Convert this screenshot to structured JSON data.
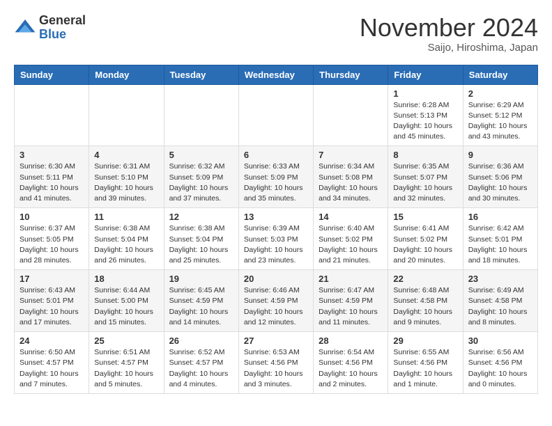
{
  "logo": {
    "general": "General",
    "blue": "Blue"
  },
  "title": "November 2024",
  "subtitle": "Saijo, Hiroshima, Japan",
  "days_header": [
    "Sunday",
    "Monday",
    "Tuesday",
    "Wednesday",
    "Thursday",
    "Friday",
    "Saturday"
  ],
  "weeks": [
    [
      {
        "day": "",
        "info": ""
      },
      {
        "day": "",
        "info": ""
      },
      {
        "day": "",
        "info": ""
      },
      {
        "day": "",
        "info": ""
      },
      {
        "day": "",
        "info": ""
      },
      {
        "day": "1",
        "info": "Sunrise: 6:28 AM\nSunset: 5:13 PM\nDaylight: 10 hours and 45 minutes."
      },
      {
        "day": "2",
        "info": "Sunrise: 6:29 AM\nSunset: 5:12 PM\nDaylight: 10 hours and 43 minutes."
      }
    ],
    [
      {
        "day": "3",
        "info": "Sunrise: 6:30 AM\nSunset: 5:11 PM\nDaylight: 10 hours and 41 minutes."
      },
      {
        "day": "4",
        "info": "Sunrise: 6:31 AM\nSunset: 5:10 PM\nDaylight: 10 hours and 39 minutes."
      },
      {
        "day": "5",
        "info": "Sunrise: 6:32 AM\nSunset: 5:09 PM\nDaylight: 10 hours and 37 minutes."
      },
      {
        "day": "6",
        "info": "Sunrise: 6:33 AM\nSunset: 5:09 PM\nDaylight: 10 hours and 35 minutes."
      },
      {
        "day": "7",
        "info": "Sunrise: 6:34 AM\nSunset: 5:08 PM\nDaylight: 10 hours and 34 minutes."
      },
      {
        "day": "8",
        "info": "Sunrise: 6:35 AM\nSunset: 5:07 PM\nDaylight: 10 hours and 32 minutes."
      },
      {
        "day": "9",
        "info": "Sunrise: 6:36 AM\nSunset: 5:06 PM\nDaylight: 10 hours and 30 minutes."
      }
    ],
    [
      {
        "day": "10",
        "info": "Sunrise: 6:37 AM\nSunset: 5:05 PM\nDaylight: 10 hours and 28 minutes."
      },
      {
        "day": "11",
        "info": "Sunrise: 6:38 AM\nSunset: 5:04 PM\nDaylight: 10 hours and 26 minutes."
      },
      {
        "day": "12",
        "info": "Sunrise: 6:38 AM\nSunset: 5:04 PM\nDaylight: 10 hours and 25 minutes."
      },
      {
        "day": "13",
        "info": "Sunrise: 6:39 AM\nSunset: 5:03 PM\nDaylight: 10 hours and 23 minutes."
      },
      {
        "day": "14",
        "info": "Sunrise: 6:40 AM\nSunset: 5:02 PM\nDaylight: 10 hours and 21 minutes."
      },
      {
        "day": "15",
        "info": "Sunrise: 6:41 AM\nSunset: 5:02 PM\nDaylight: 10 hours and 20 minutes."
      },
      {
        "day": "16",
        "info": "Sunrise: 6:42 AM\nSunset: 5:01 PM\nDaylight: 10 hours and 18 minutes."
      }
    ],
    [
      {
        "day": "17",
        "info": "Sunrise: 6:43 AM\nSunset: 5:01 PM\nDaylight: 10 hours and 17 minutes."
      },
      {
        "day": "18",
        "info": "Sunrise: 6:44 AM\nSunset: 5:00 PM\nDaylight: 10 hours and 15 minutes."
      },
      {
        "day": "19",
        "info": "Sunrise: 6:45 AM\nSunset: 4:59 PM\nDaylight: 10 hours and 14 minutes."
      },
      {
        "day": "20",
        "info": "Sunrise: 6:46 AM\nSunset: 4:59 PM\nDaylight: 10 hours and 12 minutes."
      },
      {
        "day": "21",
        "info": "Sunrise: 6:47 AM\nSunset: 4:59 PM\nDaylight: 10 hours and 11 minutes."
      },
      {
        "day": "22",
        "info": "Sunrise: 6:48 AM\nSunset: 4:58 PM\nDaylight: 10 hours and 9 minutes."
      },
      {
        "day": "23",
        "info": "Sunrise: 6:49 AM\nSunset: 4:58 PM\nDaylight: 10 hours and 8 minutes."
      }
    ],
    [
      {
        "day": "24",
        "info": "Sunrise: 6:50 AM\nSunset: 4:57 PM\nDaylight: 10 hours and 7 minutes."
      },
      {
        "day": "25",
        "info": "Sunrise: 6:51 AM\nSunset: 4:57 PM\nDaylight: 10 hours and 5 minutes."
      },
      {
        "day": "26",
        "info": "Sunrise: 6:52 AM\nSunset: 4:57 PM\nDaylight: 10 hours and 4 minutes."
      },
      {
        "day": "27",
        "info": "Sunrise: 6:53 AM\nSunset: 4:56 PM\nDaylight: 10 hours and 3 minutes."
      },
      {
        "day": "28",
        "info": "Sunrise: 6:54 AM\nSunset: 4:56 PM\nDaylight: 10 hours and 2 minutes."
      },
      {
        "day": "29",
        "info": "Sunrise: 6:55 AM\nSunset: 4:56 PM\nDaylight: 10 hours and 1 minute."
      },
      {
        "day": "30",
        "info": "Sunrise: 6:56 AM\nSunset: 4:56 PM\nDaylight: 10 hours and 0 minutes."
      }
    ]
  ]
}
